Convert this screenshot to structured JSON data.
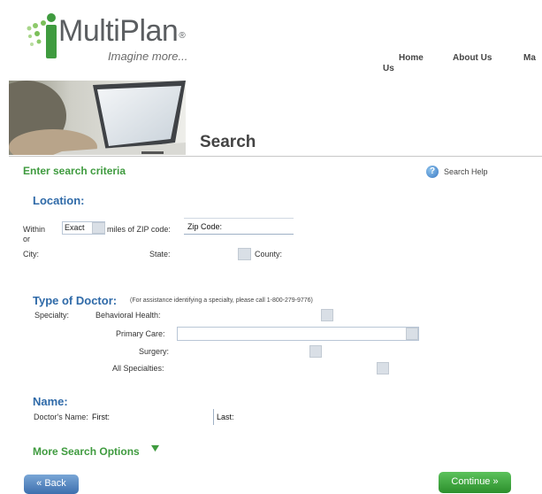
{
  "header": {
    "brand": "MultiPlan",
    "brand_mark": "®",
    "tagline": "Imagine more...",
    "nav": [
      "Home",
      "About Us",
      "Ma"
    ],
    "nav_wrap": "Us"
  },
  "page": {
    "title": "Search",
    "subtitle": "Enter search criteria",
    "help_label": "Search Help"
  },
  "location": {
    "heading": "Location:",
    "within_label": "Within",
    "within_value": "Exact",
    "miles_label": "miles of ZIP code:",
    "zip_value": "Zip Code:",
    "or_label": "or",
    "city_label": "City:",
    "state_label": "State:",
    "county_label": "County:"
  },
  "doctor_type": {
    "heading": "Type of Doctor:",
    "assist_note": "(For assistance identifying a specialty, please call 1-800-279-9776)",
    "specialty_label": "Specialty:",
    "behavioral_label": "Behavioral Health:",
    "primary_label": "Primary Care:",
    "surgery_label": "Surgery:",
    "all_label": "All Specialties:"
  },
  "name": {
    "heading": "Name:",
    "doctors_name_label": "Doctor's Name:",
    "first_label": "First:",
    "last_label": "Last:"
  },
  "more_options": "More Search Options",
  "buttons": {
    "back": "« Back",
    "continue": "Continue »"
  },
  "colors": {
    "green": "#3f9b3f",
    "blue": "#2f6aa8"
  }
}
